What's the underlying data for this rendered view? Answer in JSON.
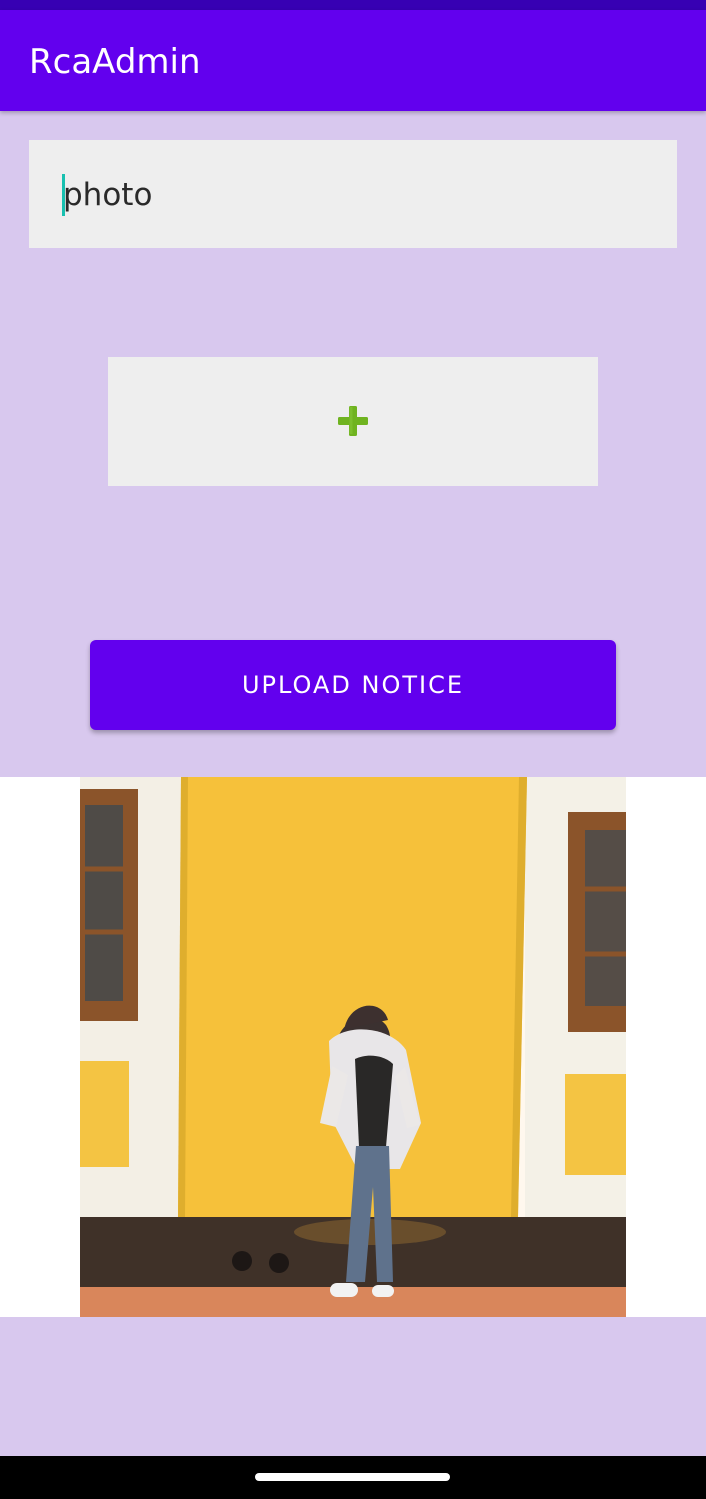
{
  "app_bar": {
    "title": "RcaAdmin",
    "color": "#6200ee",
    "status_bar_color": "#3700b3"
  },
  "notice_form": {
    "title_field_value": "photo",
    "add_image_icon": "plus-icon",
    "upload_button_label": "UPLOAD NOTICE",
    "background_color": "#d8c8ee"
  },
  "preview": {
    "icon": "selected-notice-image"
  },
  "system_nav": {
    "home_indicator": "home-indicator"
  }
}
